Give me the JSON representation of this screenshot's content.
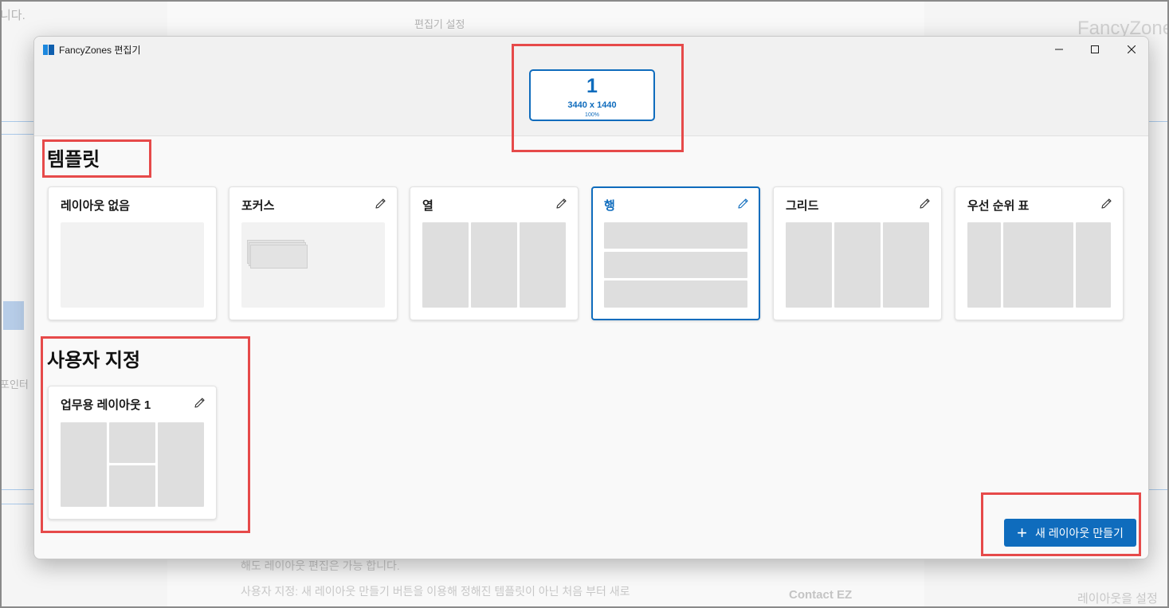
{
  "window": {
    "title": "FancyZones 편집기",
    "controls": {
      "minimize": "minimize",
      "maximize": "maximize",
      "close": "close"
    }
  },
  "monitor": {
    "number": "1",
    "resolution": "3440 x 1440",
    "scale": "100%"
  },
  "templates": {
    "heading": "템플릿",
    "items": [
      {
        "label": "레이아웃 없음",
        "type": "none",
        "editable": false,
        "selected": false
      },
      {
        "label": "포커스",
        "type": "focus",
        "editable": true,
        "selected": false
      },
      {
        "label": "열",
        "type": "columns",
        "editable": true,
        "selected": false
      },
      {
        "label": "행",
        "type": "rows",
        "editable": true,
        "selected": true
      },
      {
        "label": "그리드",
        "type": "grid",
        "editable": true,
        "selected": false
      },
      {
        "label": "우선 순위 표",
        "type": "priority-grid",
        "editable": true,
        "selected": false
      }
    ]
  },
  "custom": {
    "heading": "사용자 지정",
    "items": [
      {
        "label": "업무용 레이아웃 1",
        "editable": true
      }
    ]
  },
  "new_layout_button": {
    "icon": "+",
    "label": "새 레이아웃 만들기"
  },
  "background_page": {
    "texts": [
      "니다.",
      "편집기 설정",
      "FancyZone",
      "포인터",
      "Contact EZ",
      "레이아웃을 설정",
      "사용자 지정: 새 레이아웃 만들기 버튼을 이용해 정해진 템플릿이 아닌 처음 부터 새로",
      "해도 레이아웃 편집은 가능 합니다."
    ]
  },
  "colors": {
    "accent": "#0f6cbd",
    "annotation": "#e64a4a",
    "zone": "#dedede"
  }
}
